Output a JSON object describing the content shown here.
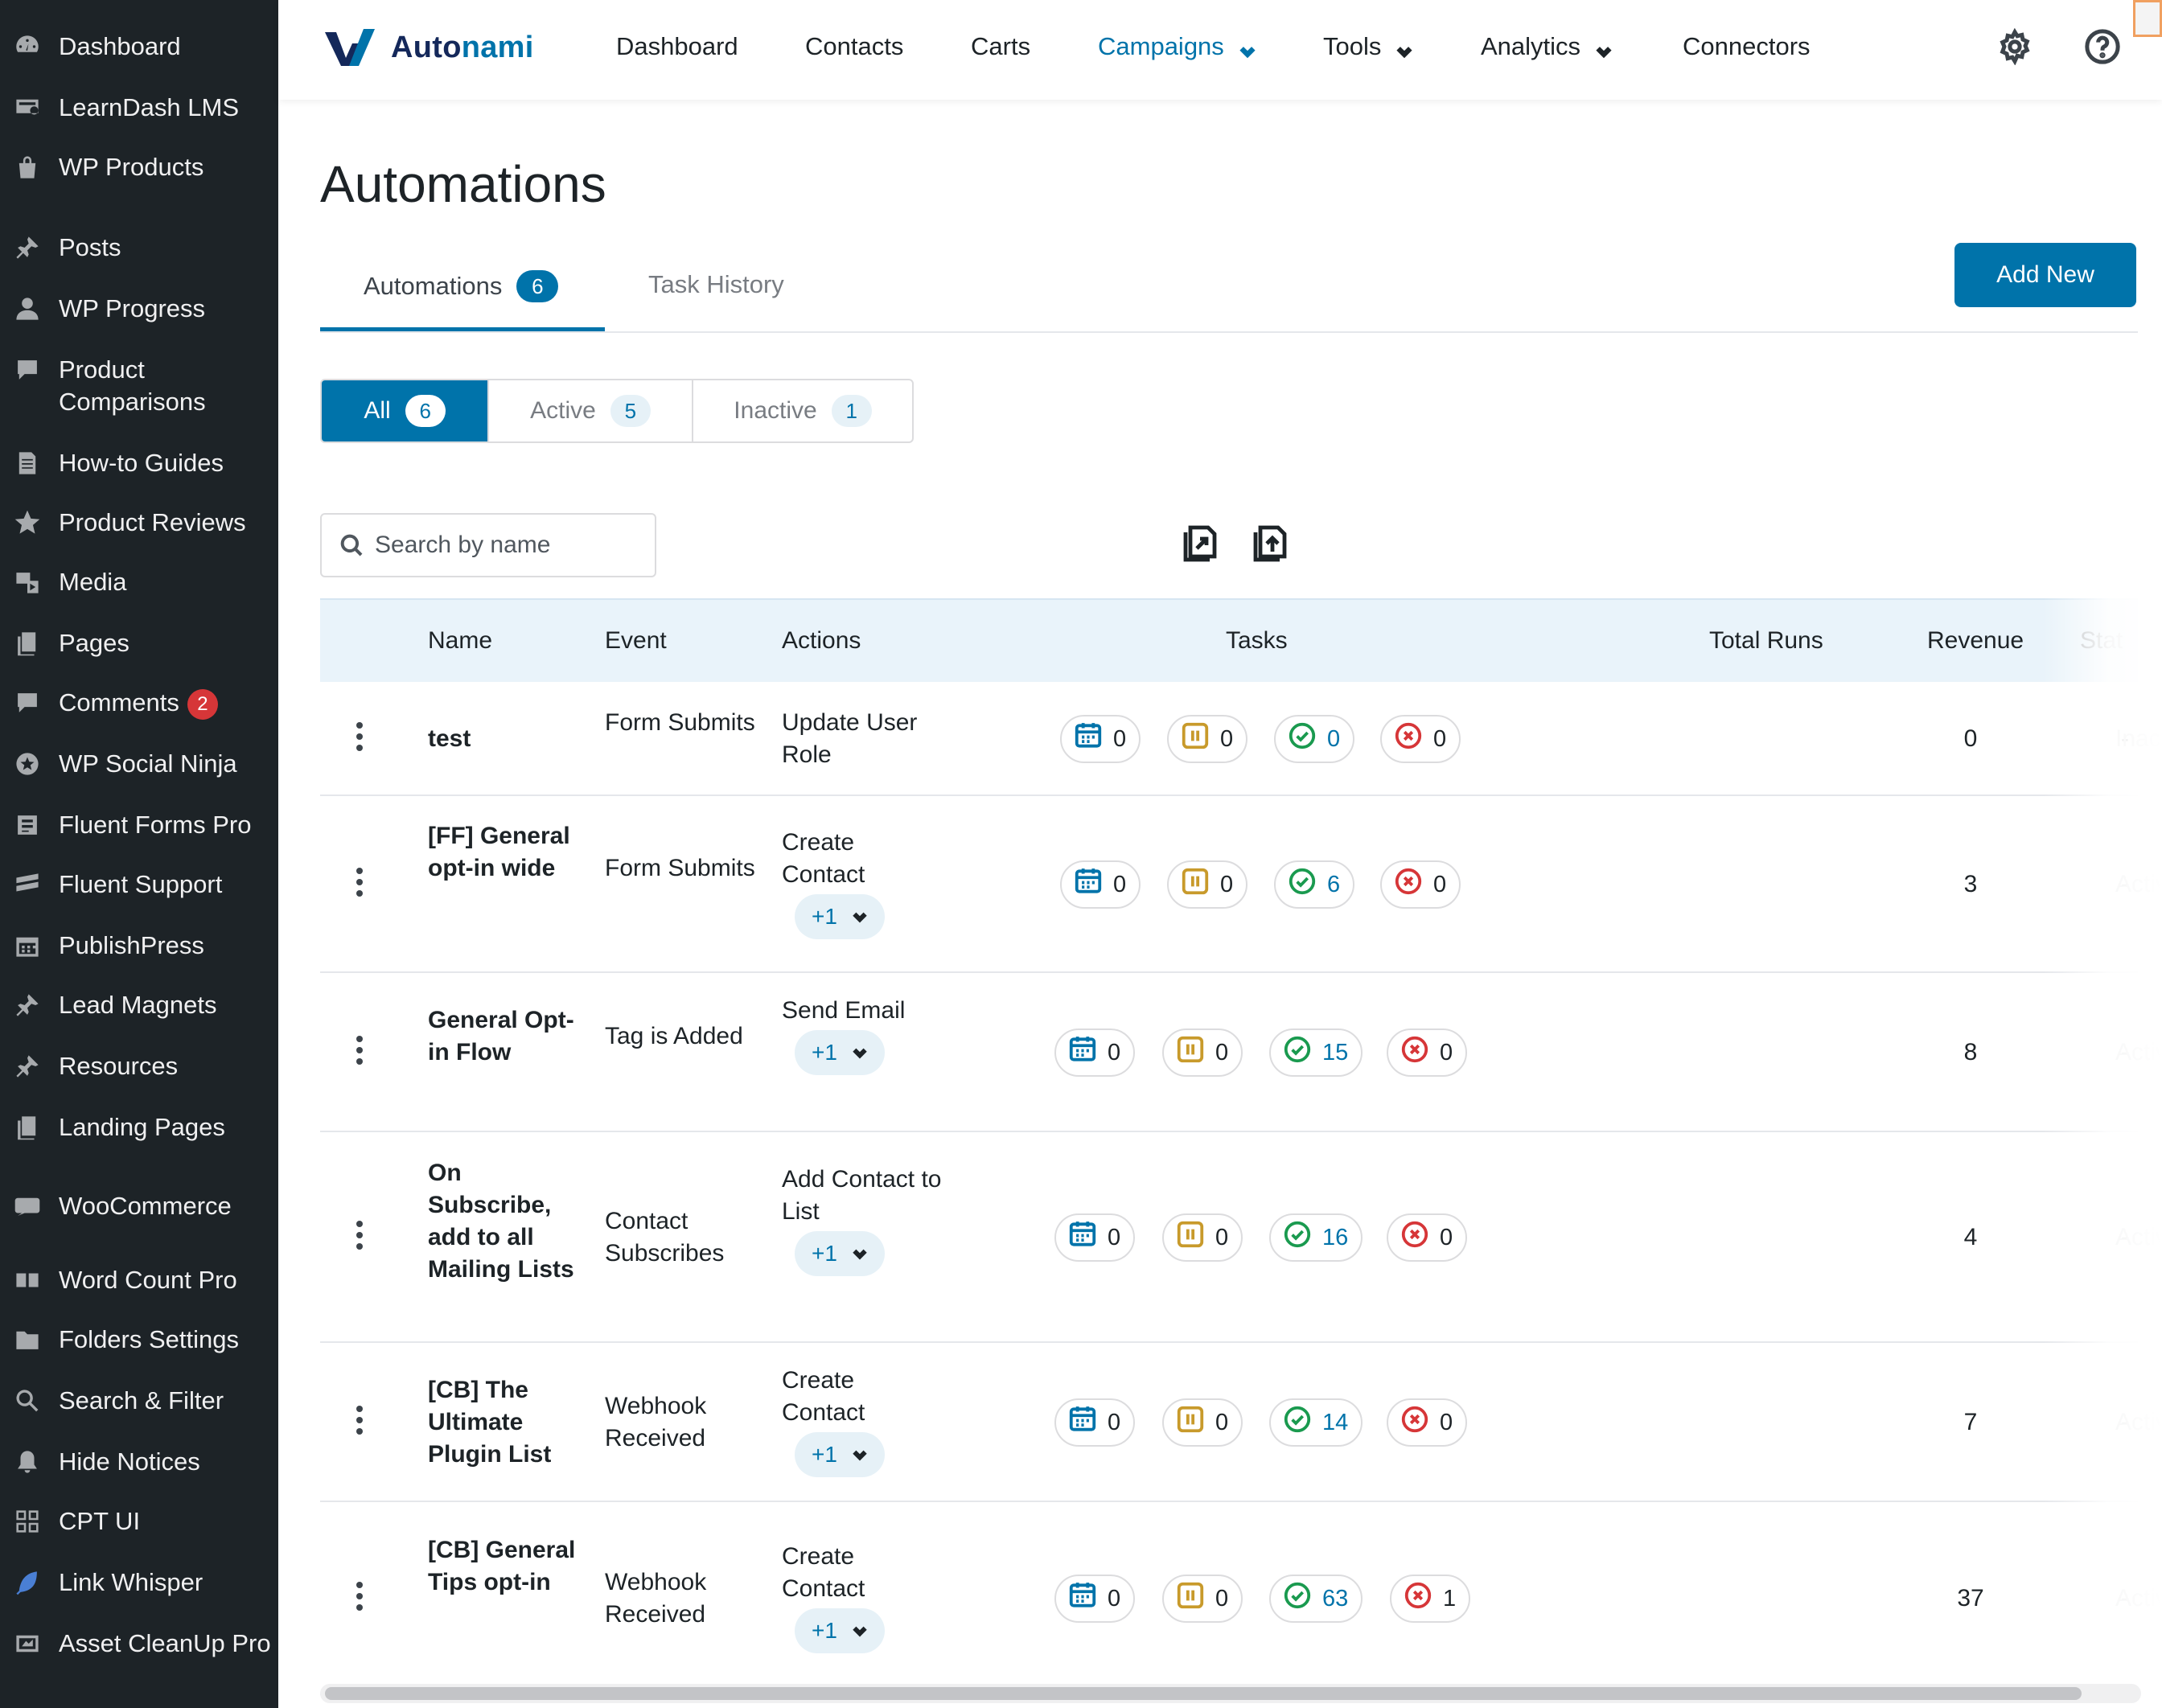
{
  "sidebar": {
    "items": [
      {
        "label": "Dashboard",
        "icon": "dashboard-icon"
      },
      {
        "label": "LearnDash LMS",
        "icon": "learndash-icon"
      },
      {
        "label": "WP Products",
        "icon": "bag-icon"
      },
      {
        "label": "Posts",
        "icon": "pin-icon"
      },
      {
        "label": "WP Progress",
        "icon": "user-icon"
      },
      {
        "label": "Product Comparisons",
        "icon": "bubble-icon"
      },
      {
        "label": "How-to Guides",
        "icon": "document-icon"
      },
      {
        "label": "Product Reviews",
        "icon": "star-icon"
      },
      {
        "label": "Media",
        "icon": "media-icon"
      },
      {
        "label": "Pages",
        "icon": "pages-icon"
      },
      {
        "label": "Comments",
        "icon": "comment-icon",
        "badge": "2"
      },
      {
        "label": "WP Social Ninja",
        "icon": "ninja-icon"
      },
      {
        "label": "Fluent Forms Pro",
        "icon": "forms-icon"
      },
      {
        "label": "Fluent Support",
        "icon": "support-icon"
      },
      {
        "label": "PublishPress",
        "icon": "calendar-icon"
      },
      {
        "label": "Lead Magnets",
        "icon": "pin-icon"
      },
      {
        "label": "Resources",
        "icon": "pin-icon"
      },
      {
        "label": "Landing Pages",
        "icon": "pages-icon"
      },
      {
        "label": "WooCommerce",
        "icon": "woo-icon"
      },
      {
        "label": "Word Count Pro",
        "icon": "wordcount-icon"
      },
      {
        "label": "Folders Settings",
        "icon": "folder-icon"
      },
      {
        "label": "Search & Filter",
        "icon": "search-icon"
      },
      {
        "label": "Hide Notices",
        "icon": "bell-icon"
      },
      {
        "label": "CPT UI",
        "icon": "grid-icon"
      },
      {
        "label": "Link Whisper",
        "icon": "feather-icon"
      },
      {
        "label": "Asset CleanUp Pro",
        "icon": "gauge-icon"
      }
    ]
  },
  "topbar": {
    "brand_part1": "Auto",
    "brand_part2": "nami",
    "nav": [
      {
        "label": "Dashboard"
      },
      {
        "label": "Contacts"
      },
      {
        "label": "Carts"
      },
      {
        "label": "Campaigns",
        "active": true,
        "dropdown": true
      },
      {
        "label": "Tools",
        "dropdown": true
      },
      {
        "label": "Analytics",
        "dropdown": true
      },
      {
        "label": "Connectors"
      }
    ],
    "icons": [
      "settings-icon",
      "help-icon"
    ]
  },
  "page": {
    "title": "Automations",
    "tabs": [
      {
        "label": "Automations",
        "count": "6"
      },
      {
        "label": "Task History"
      }
    ],
    "add_new_label": "Add New",
    "filters": [
      {
        "label": "All",
        "count": "6"
      },
      {
        "label": "Active",
        "count": "5"
      },
      {
        "label": "Inactive",
        "count": "1"
      }
    ],
    "search_placeholder": "Search by name"
  },
  "table": {
    "headers": {
      "name": "Name",
      "event": "Event",
      "actions": "Actions",
      "tasks": "Tasks",
      "total_runs": "Total Runs",
      "revenue": "Revenue",
      "status": "Stat"
    },
    "rows": [
      {
        "name": "test",
        "event": "Form Submits",
        "action": "Update User Role",
        "more": "",
        "tasks": {
          "scheduled": "0",
          "paused": "0",
          "completed": "0",
          "failed": "0"
        },
        "runs": "0",
        "revenue": "-",
        "status": "Inacti"
      },
      {
        "name": "[FF] General opt-in wide",
        "event": "Form Submits",
        "action": "Create Contact",
        "more": "+1",
        "tasks": {
          "scheduled": "0",
          "paused": "0",
          "completed": "6",
          "failed": "0"
        },
        "runs": "3",
        "revenue": "-",
        "status": "Activ"
      },
      {
        "name": "General Opt-in Flow",
        "event": "Tag is Added",
        "action": "Send Email",
        "more": "+1",
        "tasks": {
          "scheduled": "0",
          "paused": "0",
          "completed": "15",
          "failed": "0"
        },
        "runs": "8",
        "revenue": "-",
        "status": "Activ"
      },
      {
        "name": "On Subscribe, add to all Mailing Lists",
        "event": "Contact Subscribes",
        "action": "Add Contact to List",
        "more": "+1",
        "tasks": {
          "scheduled": "0",
          "paused": "0",
          "completed": "16",
          "failed": "0"
        },
        "runs": "4",
        "revenue": "-",
        "status": "Activ"
      },
      {
        "name": "[CB] The Ultimate Plugin List",
        "event": "Webhook Received",
        "action": "Create Contact",
        "more": "+1",
        "tasks": {
          "scheduled": "0",
          "paused": "0",
          "completed": "14",
          "failed": "0"
        },
        "runs": "7",
        "revenue": "-",
        "status": "Activ"
      },
      {
        "name": "[CB] General Tips opt-in",
        "event": "Webhook Received",
        "action": "Create Contact",
        "more": "+1",
        "tasks": {
          "scheduled": "0",
          "paused": "0",
          "completed": "63",
          "failed": "1"
        },
        "runs": "37",
        "revenue": "-",
        "status": "Activ"
      }
    ]
  },
  "colors": {
    "sidebar_bg": "#1d2327",
    "accent": "#0073aa",
    "brand_dark": "#14285a",
    "badge_red": "#d63638",
    "success_green": "#1a9a4f",
    "pause_amber": "#c89a2b"
  }
}
